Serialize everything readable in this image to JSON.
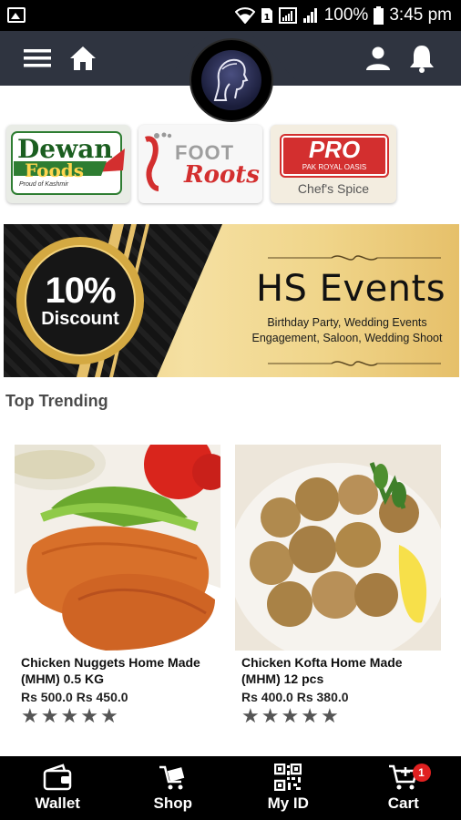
{
  "status_bar": {
    "icons": [
      "gallery-icon",
      "wifi-icon",
      "sim-icon",
      "signal-icon"
    ],
    "battery": "100%",
    "time": "3:45 pm"
  },
  "header": {
    "icons": [
      "menu-icon",
      "home-icon",
      "user-icon",
      "bell-icon"
    ],
    "logo": "woman-profile-logo"
  },
  "brands": [
    {
      "name": "Dewan Foods",
      "line1": "Dewan",
      "line2": "Foods",
      "tagline": "Proud of Kashmir"
    },
    {
      "name": "Foot Roots",
      "line1": "FOOT",
      "line2": "Roots"
    },
    {
      "name": "PRO Pak Royal Oasis",
      "line1": "PRO",
      "line2": "PAK ROYAL OASIS",
      "tagline": "Chef's Spice"
    }
  ],
  "banner": {
    "badge_pct": "10%",
    "badge_word": "Discount",
    "title": "HS Events",
    "subtitle_1": "Birthday Party, Wedding Events",
    "subtitle_2": "Engagement, Saloon, Wedding Shoot"
  },
  "section_title": "Top Trending",
  "products": [
    {
      "title": "Chicken Nuggets Home Made (MHM)  0.5 KG",
      "price_text": "Rs 500.0  Rs 450.0",
      "rating": 5
    },
    {
      "title": "Chicken Kofta Home Made (MHM) 12 pcs",
      "price_text": "Rs 400.0  Rs 380.0",
      "rating": 5
    }
  ],
  "bottom_nav": [
    {
      "label": "Wallet",
      "icon": "wallet-icon"
    },
    {
      "label": "Shop",
      "icon": "shop-icon"
    },
    {
      "label": "My ID",
      "icon": "qr-code-icon"
    },
    {
      "label": "Cart",
      "icon": "cart-icon",
      "badge": "1"
    }
  ],
  "colors": {
    "navbar": "#2f3440",
    "status_bar": "#000000",
    "bottom_nav": "#000000",
    "gold": "#e8c76e",
    "cart_badge": "#e02020"
  }
}
